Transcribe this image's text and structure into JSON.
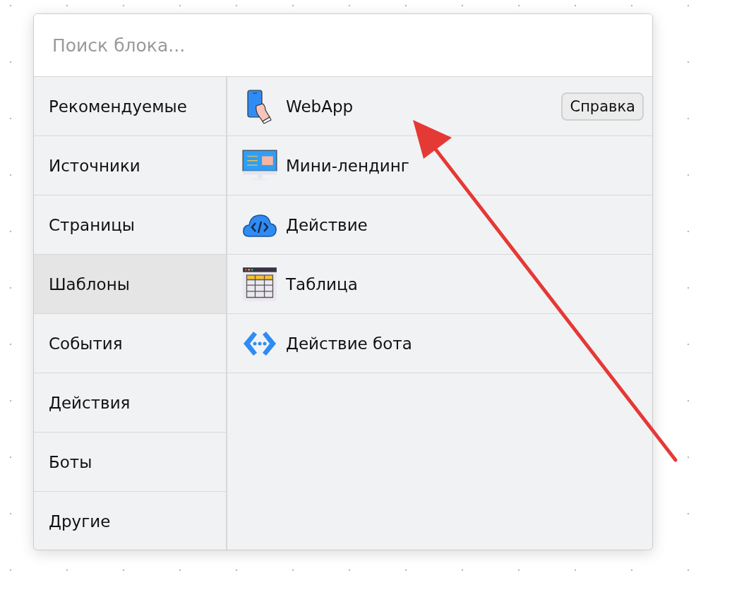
{
  "search": {
    "placeholder": "Поиск блока..."
  },
  "categories": [
    {
      "label": "Рекомендуемые",
      "selected": false
    },
    {
      "label": "Источники",
      "selected": false
    },
    {
      "label": "Страницы",
      "selected": false
    },
    {
      "label": "Шаблоны",
      "selected": true
    },
    {
      "label": "События",
      "selected": false
    },
    {
      "label": "Действия",
      "selected": false
    },
    {
      "label": "Боты",
      "selected": false
    },
    {
      "label": "Другие",
      "selected": false
    }
  ],
  "blocks": [
    {
      "label": "WebApp",
      "help_button": "Справка"
    },
    {
      "label": "Мини-лендинг"
    },
    {
      "label": "Действие"
    },
    {
      "label": "Таблица"
    },
    {
      "label": "Действие бота"
    }
  ]
}
